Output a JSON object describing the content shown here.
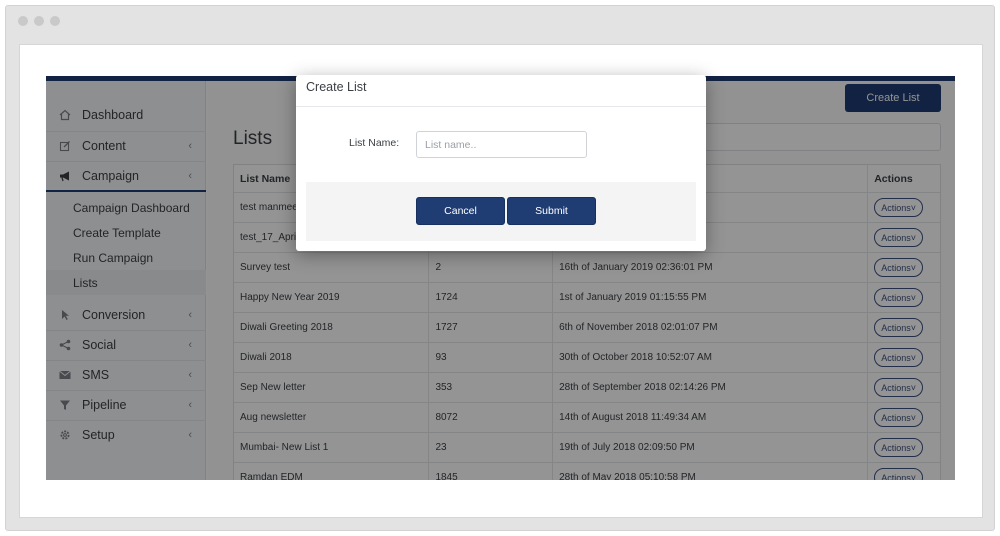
{
  "sidebar": {
    "items": [
      {
        "label": "Dashboard",
        "icon": "home-icon"
      },
      {
        "label": "Content",
        "icon": "edit-icon"
      },
      {
        "label": "Campaign",
        "icon": "megaphone-icon"
      }
    ],
    "subitems": [
      "Campaign Dashboard",
      "Create Template",
      "Run Campaign",
      "Lists"
    ],
    "lower_items": [
      {
        "label": "Conversion",
        "icon": "cursor-icon"
      },
      {
        "label": "Social",
        "icon": "share-icon"
      },
      {
        "label": "SMS",
        "icon": "envelope-icon"
      },
      {
        "label": "Pipeline",
        "icon": "filter-icon"
      },
      {
        "label": "Setup",
        "icon": "gear-icon"
      }
    ]
  },
  "main": {
    "create_button": "Create List",
    "title": "Lists",
    "columns": [
      "List Name",
      "",
      "",
      "Actions"
    ],
    "action_label": "Actions",
    "rows": [
      {
        "name": "test manmeet",
        "count": "",
        "date": ""
      },
      {
        "name": "test_17_April",
        "count": "",
        "date": ""
      },
      {
        "name": "Survey test",
        "count": "2",
        "date": "16th of January 2019 02:36:01 PM"
      },
      {
        "name": "Happy New Year 2019",
        "count": "1724",
        "date": "1st of January 2019 01:15:55 PM"
      },
      {
        "name": "Diwali Greeting 2018",
        "count": "1727",
        "date": "6th of November 2018 02:01:07 PM"
      },
      {
        "name": "Diwali 2018",
        "count": "93",
        "date": "30th of October 2018 10:52:07 AM"
      },
      {
        "name": "Sep New letter",
        "count": "353",
        "date": "28th of September 2018 02:14:26 PM"
      },
      {
        "name": "Aug newsletter",
        "count": "8072",
        "date": "14th of August 2018 11:49:34 AM"
      },
      {
        "name": "Mumbai- New List 1",
        "count": "23",
        "date": "19th of July 2018 02:09:50 PM"
      },
      {
        "name": "Ramdan EDM",
        "count": "1845",
        "date": "28th of May 2018 05:10:58 PM"
      }
    ]
  },
  "modal": {
    "title": "Create List",
    "field_label": "List Name:",
    "field_placeholder": "List name..",
    "field_value": "",
    "cancel_label": "Cancel",
    "submit_label": "Submit"
  },
  "colors": {
    "brand": "#1f3c73",
    "overlay": "rgba(0,0,0,0.42)"
  }
}
